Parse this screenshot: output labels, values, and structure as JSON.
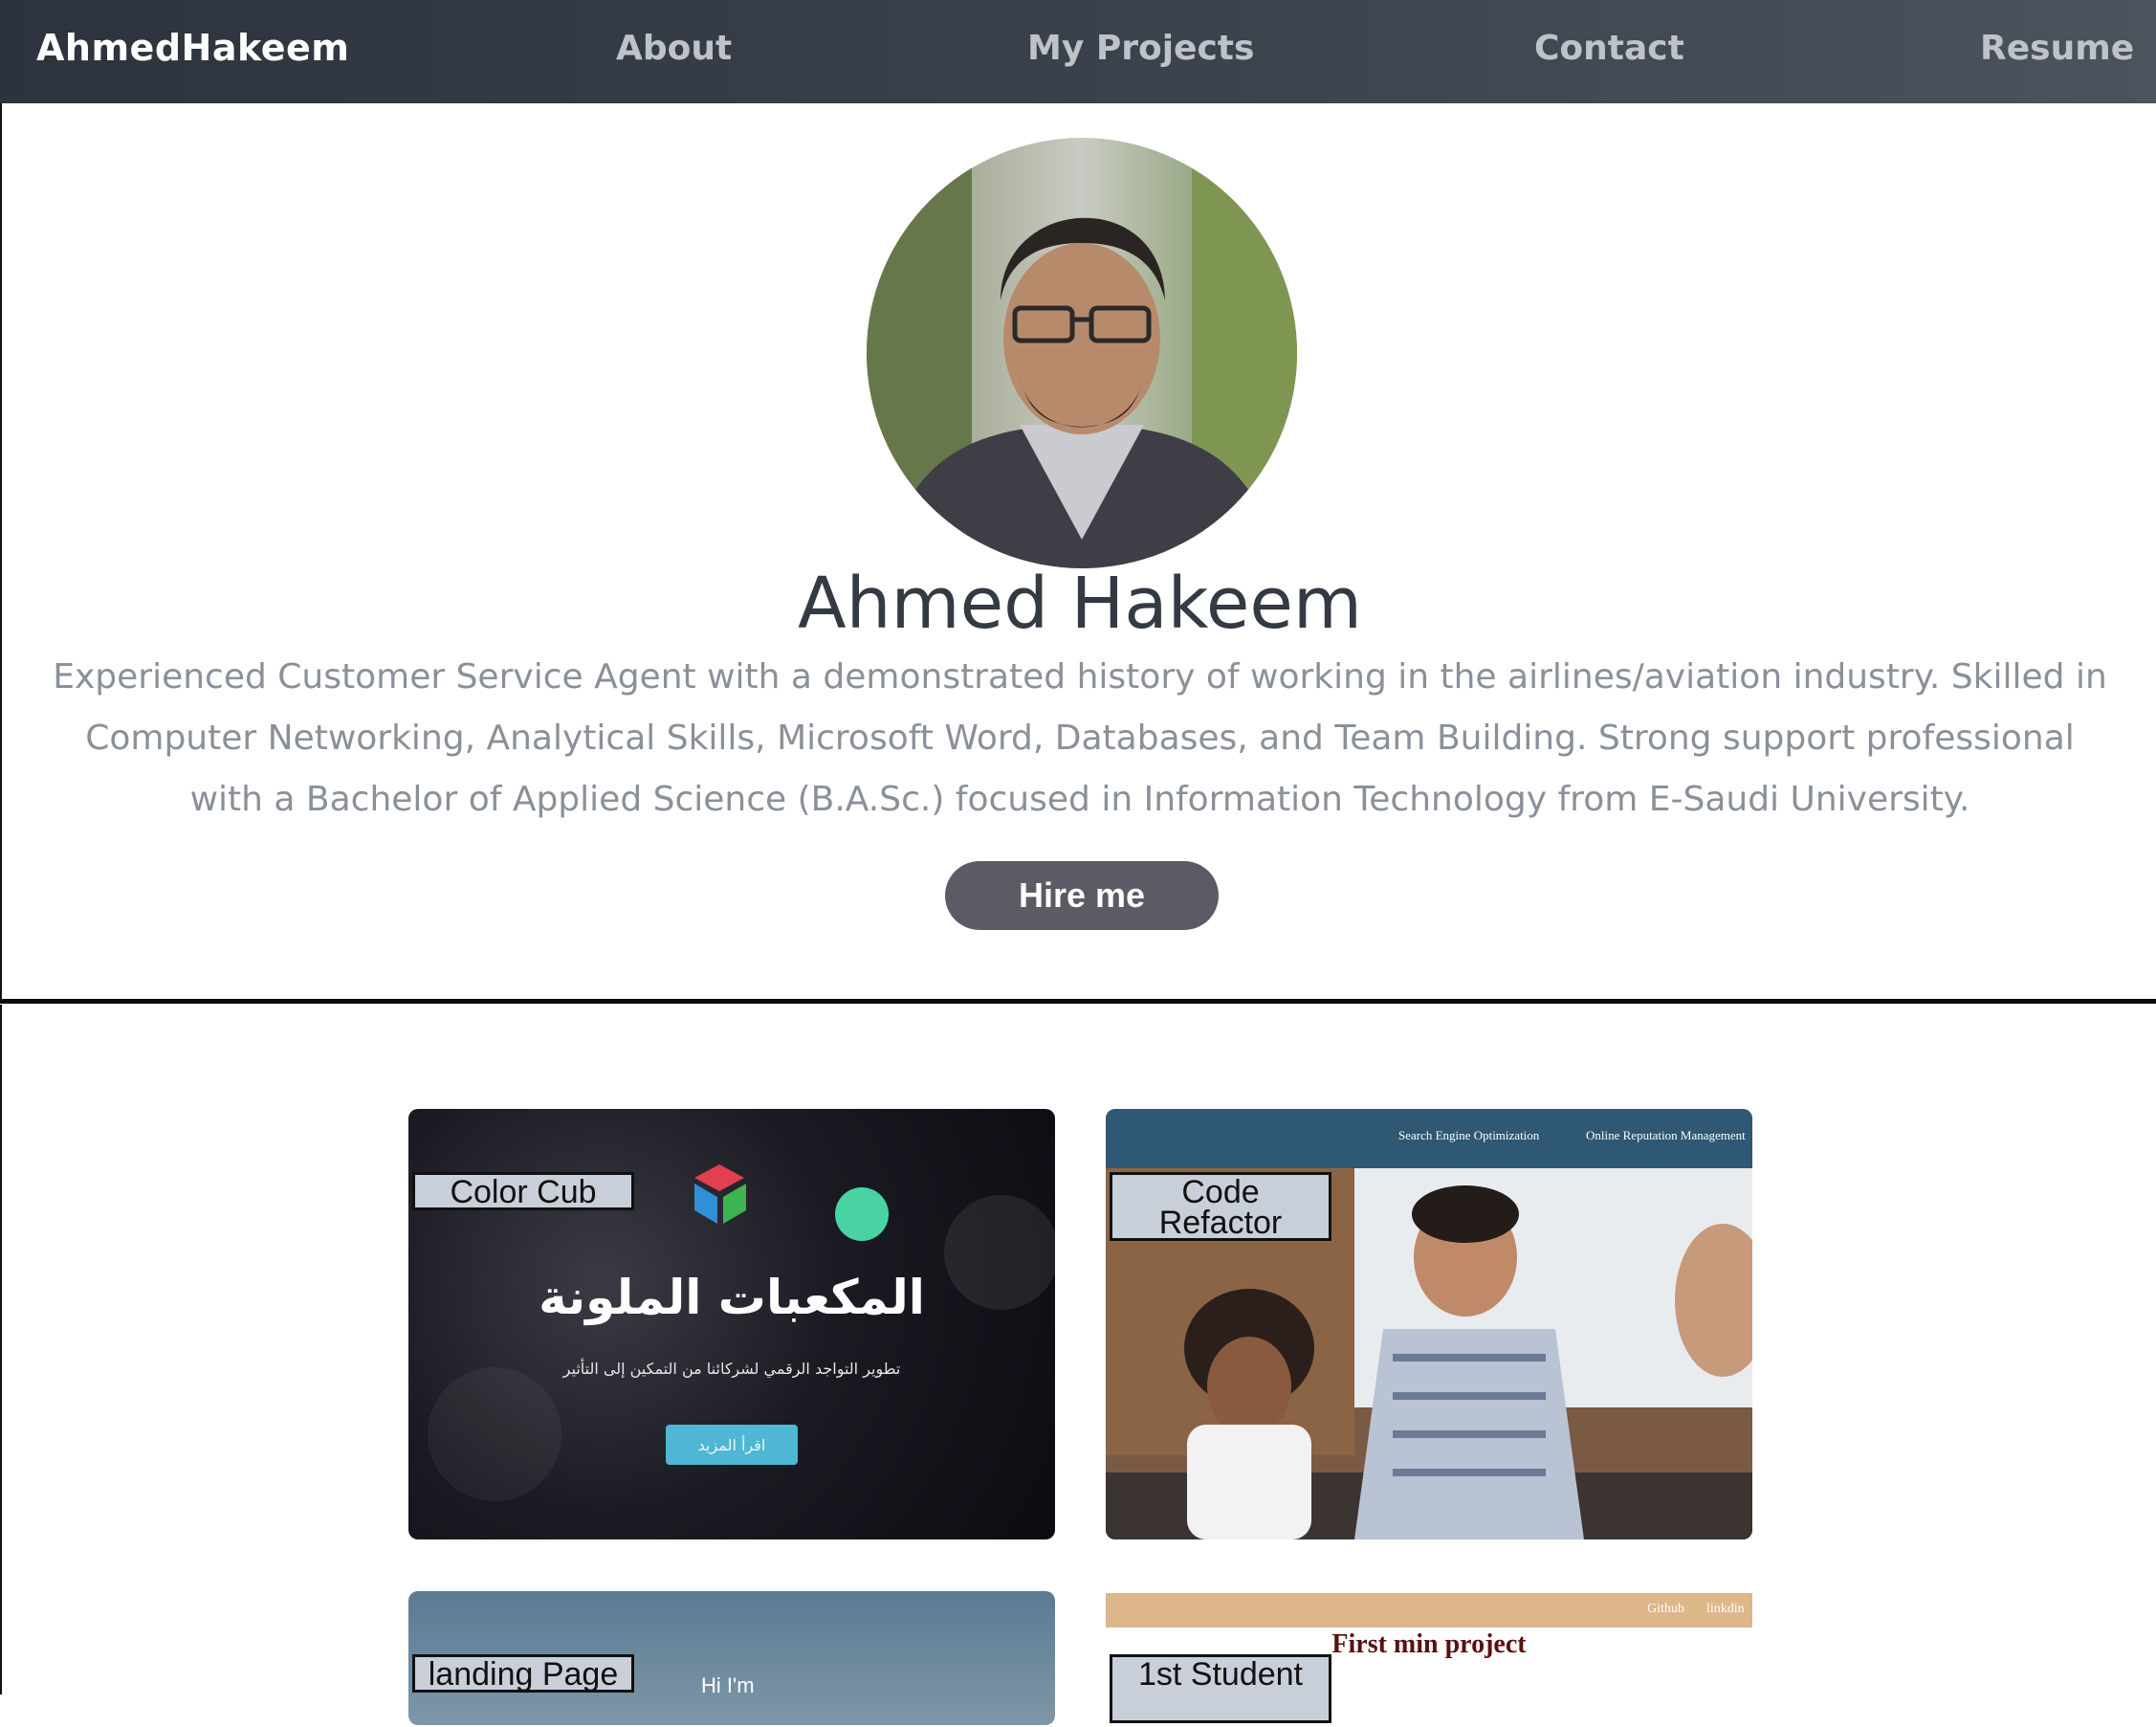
{
  "nav": {
    "brand": "AhmedHakeem",
    "links": [
      "About",
      "My Projects",
      "Contact",
      "Resume"
    ]
  },
  "hero": {
    "name": "Ahmed Hakeem",
    "bio": "Experienced Customer Service Agent with a demonstrated history of working in the airlines/aviation industry. Skilled in Computer Networking, Analytical Skills, Microsoft Word, Databases, and Team Building. Strong support professional with a Bachelor of Applied Science (B.A.Sc.) focused in Information Technology from E-Saudi University.",
    "hire_label": "Hire me"
  },
  "projects": [
    {
      "label": "Color Cub",
      "preview_title": "المكعبات الملونة",
      "preview_subtitle": "تطوير التواجد الرقمي لشركائنا من التمكين إلى التأثير",
      "preview_button": "اقرأ المزيد"
    },
    {
      "label": "Code Refactor",
      "preview_links": [
        "Search Engine Optimization",
        "Online Reputation Management"
      ]
    },
    {
      "label": "landing Page",
      "preview_text": "Hi I'm"
    },
    {
      "label": "1st Student",
      "preview_title": "First min project",
      "preview_links": [
        "Github",
        "linkdin"
      ]
    }
  ],
  "colors": {
    "nav_bg": "#343b45",
    "hire_bg": "#5c5a64",
    "label_bg": "#c9cfd9"
  }
}
